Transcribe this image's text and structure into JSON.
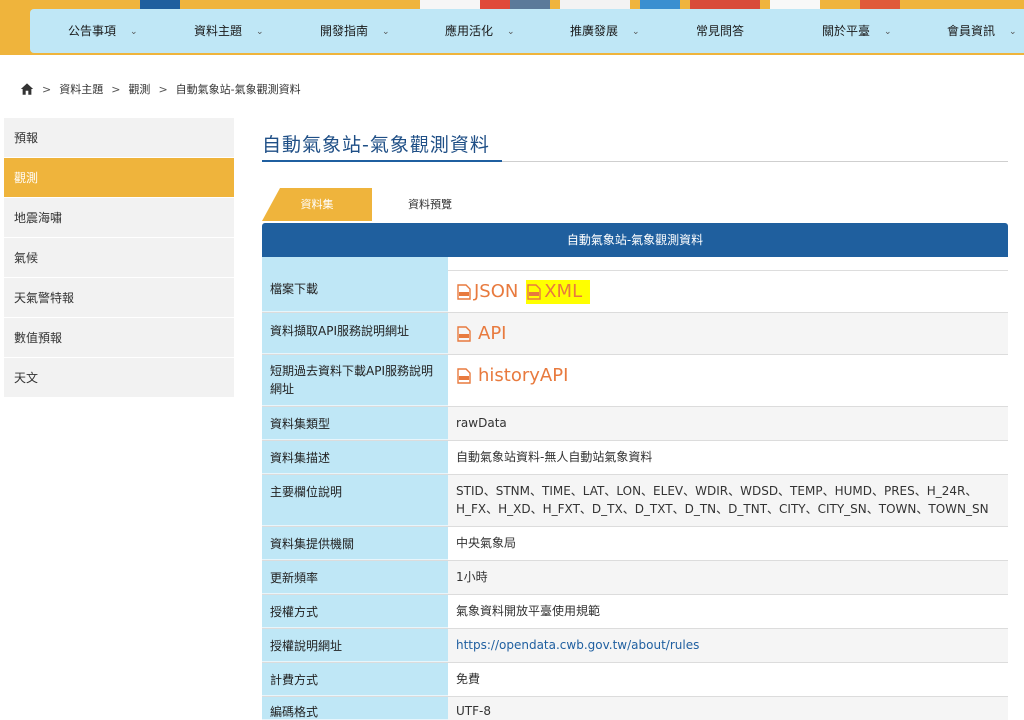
{
  "nav": {
    "items": [
      {
        "label": "公告事項",
        "chevron": true
      },
      {
        "label": "資料主題",
        "chevron": true
      },
      {
        "label": "開發指南",
        "chevron": true
      },
      {
        "label": "應用活化",
        "chevron": true
      },
      {
        "label": "推廣發展",
        "chevron": true
      },
      {
        "label": "常見問答",
        "chevron": false
      },
      {
        "label": "關於平臺",
        "chevron": true
      },
      {
        "label": "會員資訊",
        "chevron": true
      }
    ]
  },
  "breadcrumb": {
    "items": [
      "資料主題",
      "觀測",
      "自動氣象站-氣象觀測資料"
    ],
    "separator": ">"
  },
  "sidebar": {
    "items": [
      {
        "label": "預報",
        "active": false
      },
      {
        "label": "觀測",
        "active": true
      },
      {
        "label": "地震海嘯",
        "active": false
      },
      {
        "label": "氣候",
        "active": false
      },
      {
        "label": "天氣警特報",
        "active": false
      },
      {
        "label": "數值預報",
        "active": false
      },
      {
        "label": "天文",
        "active": false
      }
    ]
  },
  "main": {
    "title": "自動氣象站-氣象觀測資料",
    "tabs": [
      {
        "label": "資料集",
        "active": true
      },
      {
        "label": "資料預覽",
        "active": false
      }
    ],
    "table": {
      "header": "自動氣象站-氣象觀測資料",
      "rows": {
        "download": {
          "label": "檔案下載",
          "links": [
            "JSON",
            "XML"
          ]
        },
        "api_doc": {
          "label": "資料擷取API服務說明網址",
          "link": "API"
        },
        "history_api": {
          "label": "短期過去資料下載API服務說明網址",
          "link": "historyAPI"
        },
        "type": {
          "label": "資料集類型",
          "value": "rawData"
        },
        "desc": {
          "label": "資料集描述",
          "value": "自動氣象站資料-無人自動站氣象資料"
        },
        "fields": {
          "label": "主要欄位說明",
          "value": "STID、STNM、TIME、LAT、LON、ELEV、WDIR、WDSD、TEMP、HUMD、PRES、H_24R、H_FX、H_XD、H_FXT、D_TX、D_TXT、D_TN、D_TNT、CITY、CITY_SN、TOWN、TOWN_SN"
        },
        "provider": {
          "label": "資料集提供機關",
          "value": "中央氣象局"
        },
        "frequency": {
          "label": "更新頻率",
          "value": "1小時"
        },
        "license": {
          "label": "授權方式",
          "value": "氣象資料開放平臺使用規範"
        },
        "license_url": {
          "label": "授權說明網址",
          "value": "https://opendata.cwb.gov.tw/about/rules"
        },
        "fee": {
          "label": "計費方式",
          "value": "免費"
        },
        "encoding": {
          "label": "編碼格式",
          "value": "UTF-8"
        }
      }
    }
  },
  "colors": {
    "accent": "#efb43c",
    "nav_bg": "#bfe7f6",
    "table_header": "#1f5f9e",
    "link_orange": "#e87a3e",
    "title_blue": "#1f4f86",
    "highlight": "#ffff00"
  },
  "icons": {
    "home": "home-icon",
    "chevron": "chevron-down-icon",
    "file": "file-download-icon"
  }
}
